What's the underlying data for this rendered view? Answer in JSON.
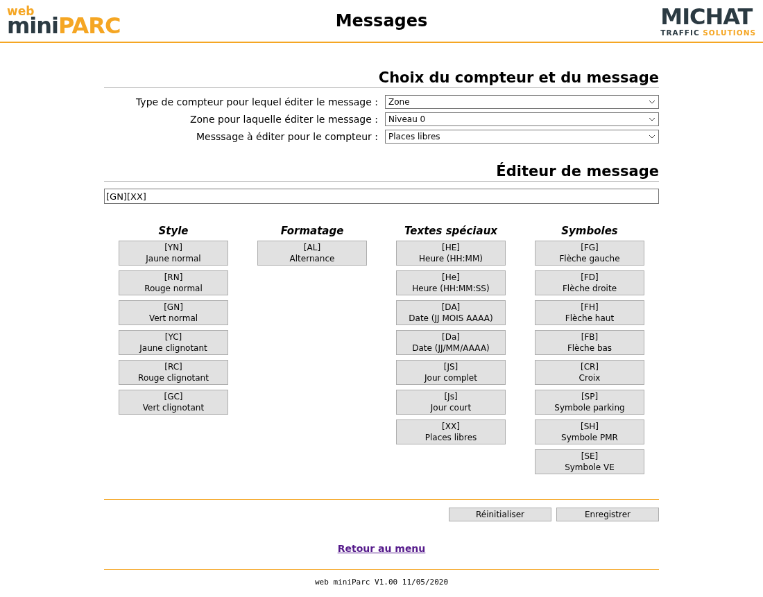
{
  "header": {
    "logo_left": {
      "small": "web",
      "dark": "mini",
      "accent": "PARC"
    },
    "title": "Messages",
    "logo_right": {
      "brand": "MICHAT",
      "tagline_dark": "TRAFFIC",
      "tagline_accent": "SOLUTIONS"
    }
  },
  "selection": {
    "title": "Choix du compteur et du message",
    "fields": [
      {
        "label": "Type de compteur pour lequel éditer le message :",
        "value": "Zone"
      },
      {
        "label": "Zone pour laquelle éditer le message :",
        "value": "Niveau 0"
      },
      {
        "label": "Messsage à éditer pour le compteur :",
        "value": "Places libres"
      }
    ]
  },
  "editor": {
    "title": "Éditeur de message",
    "value": "[GN][XX]",
    "groups": [
      {
        "title": "Style",
        "buttons": [
          {
            "code": "[YN]",
            "label": "Jaune normal"
          },
          {
            "code": "[RN]",
            "label": "Rouge normal"
          },
          {
            "code": "[GN]",
            "label": "Vert normal"
          },
          {
            "code": "[YC]",
            "label": "Jaune clignotant"
          },
          {
            "code": "[RC]",
            "label": "Rouge clignotant"
          },
          {
            "code": "[GC]",
            "label": "Vert clignotant"
          }
        ]
      },
      {
        "title": "Formatage",
        "buttons": [
          {
            "code": "[AL]",
            "label": "Alternance"
          }
        ]
      },
      {
        "title": "Textes spéciaux",
        "buttons": [
          {
            "code": "[HE]",
            "label": "Heure (HH:MM)"
          },
          {
            "code": "[He]",
            "label": "Heure (HH:MM:SS)"
          },
          {
            "code": "[DA]",
            "label": "Date (JJ MOIS AAAA)"
          },
          {
            "code": "[Da]",
            "label": "Date (JJ/MM/AAAA)"
          },
          {
            "code": "[JS]",
            "label": "Jour complet"
          },
          {
            "code": "[Js]",
            "label": "Jour court"
          },
          {
            "code": "[XX]",
            "label": "Places libres"
          }
        ]
      },
      {
        "title": "Symboles",
        "buttons": [
          {
            "code": "[FG]",
            "label": "Flèche gauche"
          },
          {
            "code": "[FD]",
            "label": "Flèche droite"
          },
          {
            "code": "[FH]",
            "label": "Flèche haut"
          },
          {
            "code": "[FB]",
            "label": "Flèche bas"
          },
          {
            "code": "[CR]",
            "label": "Croix"
          },
          {
            "code": "[SP]",
            "label": "Symbole parking"
          },
          {
            "code": "[SH]",
            "label": "Symbole PMR"
          },
          {
            "code": "[SE]",
            "label": "Symbole VE"
          }
        ]
      }
    ]
  },
  "actions": [
    "Réinitialiser",
    "Enregistrer"
  ],
  "back_link": "Retour au menu",
  "footer": "web miniParc V1.00 11/05/2020"
}
